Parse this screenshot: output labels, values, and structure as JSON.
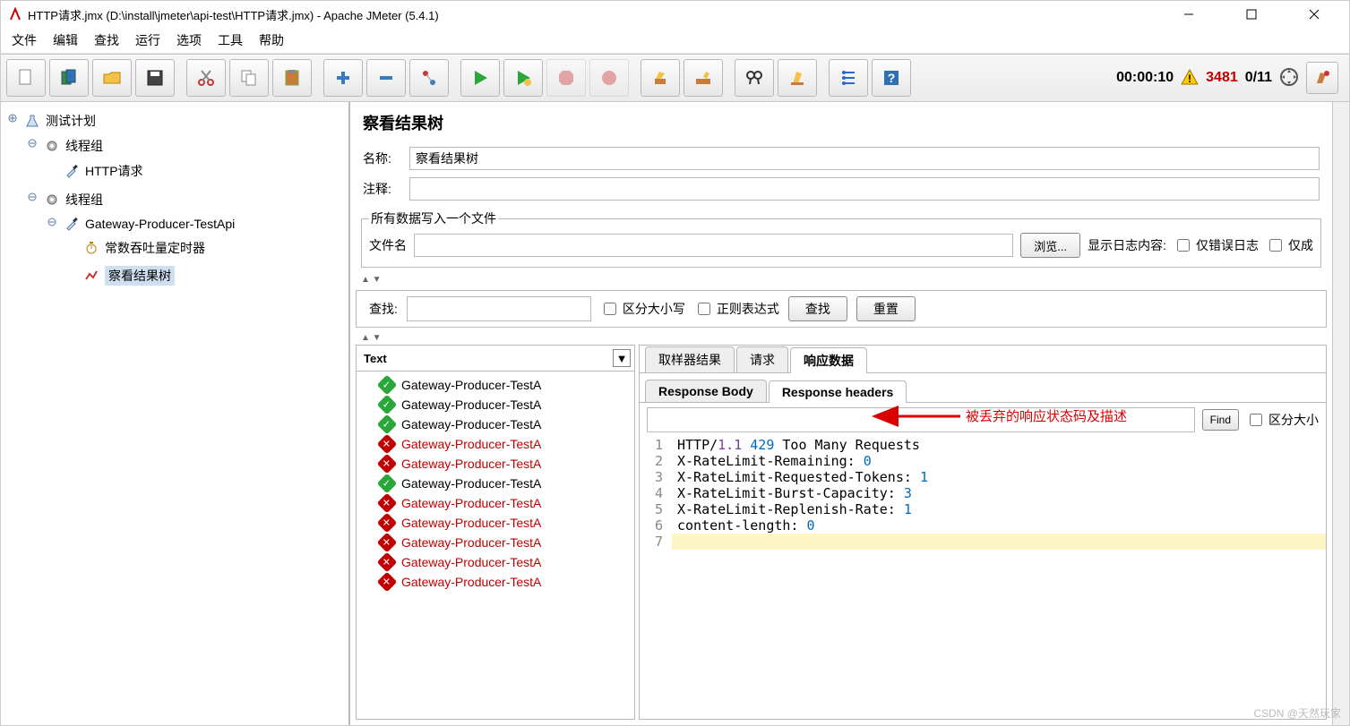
{
  "window": {
    "title": "HTTP请求.jmx (D:\\install\\jmeter\\api-test\\HTTP请求.jmx) - Apache JMeter (5.4.1)"
  },
  "menu": {
    "items": [
      "文件",
      "编辑",
      "查找",
      "运行",
      "选项",
      "工具",
      "帮助"
    ]
  },
  "status": {
    "timer": "00:00:10",
    "warn_num": "3481",
    "count": "0/11"
  },
  "tree": {
    "root": "测试计划",
    "tg1": "线程组",
    "http": "HTTP请求",
    "tg2": "线程组",
    "api": "Gateway-Producer-TestApi",
    "timer": "常数吞吐量定时器",
    "view": "察看结果树"
  },
  "panel": {
    "title": "察看结果树",
    "name_label": "名称:",
    "name_value": "察看结果树",
    "note_label": "注释:",
    "note_value": ""
  },
  "file": {
    "legend": "所有数据写入一个文件",
    "name_label": "文件名",
    "browse": "浏览...",
    "show_label": "显示日志内容:",
    "chk_err": "仅错误日志",
    "chk_succ": "仅成"
  },
  "search": {
    "label": "查找:",
    "case": "区分大小写",
    "regex": "正则表达式",
    "find": "查找",
    "reset": "重置"
  },
  "results": {
    "dropdown": "Text",
    "rows": [
      {
        "ok": true,
        "label": "Gateway-Producer-TestA"
      },
      {
        "ok": true,
        "label": "Gateway-Producer-TestA"
      },
      {
        "ok": true,
        "label": "Gateway-Producer-TestA"
      },
      {
        "ok": false,
        "label": "Gateway-Producer-TestA"
      },
      {
        "ok": false,
        "label": "Gateway-Producer-TestA"
      },
      {
        "ok": true,
        "label": "Gateway-Producer-TestA"
      },
      {
        "ok": false,
        "label": "Gateway-Producer-TestA"
      },
      {
        "ok": false,
        "label": "Gateway-Producer-TestA"
      },
      {
        "ok": false,
        "label": "Gateway-Producer-TestA"
      },
      {
        "ok": false,
        "label": "Gateway-Producer-TestA"
      },
      {
        "ok": false,
        "label": "Gateway-Producer-TestA"
      }
    ]
  },
  "resp": {
    "tabs": [
      "取样器结果",
      "请求",
      "响应数据"
    ],
    "active_tab": 2,
    "subtabs": [
      "Response Body",
      "Response headers"
    ],
    "active_subtab": 1,
    "find": "Find",
    "case": "区分大小",
    "annotation": "被丢弃的响应状态码及描述",
    "lines": [
      {
        "n": "1",
        "html": "HTTP/<span class='kw'>1.1</span> <span class='num'>429</span> Too Many Requests"
      },
      {
        "n": "2",
        "html": "X-RateLimit-Remaining: <span class='num'>0</span>"
      },
      {
        "n": "3",
        "html": "X-RateLimit-Requested-Tokens: <span class='num'>1</span>"
      },
      {
        "n": "4",
        "html": "X-RateLimit-Burst-Capacity: <span class='num'>3</span>"
      },
      {
        "n": "5",
        "html": "X-RateLimit-Replenish-Rate: <span class='num'>1</span>"
      },
      {
        "n": "6",
        "html": "content-length: <span class='num'>0</span>"
      },
      {
        "n": "7",
        "html": "",
        "hl": true
      }
    ]
  },
  "watermark": "CSDN @天然玩家"
}
